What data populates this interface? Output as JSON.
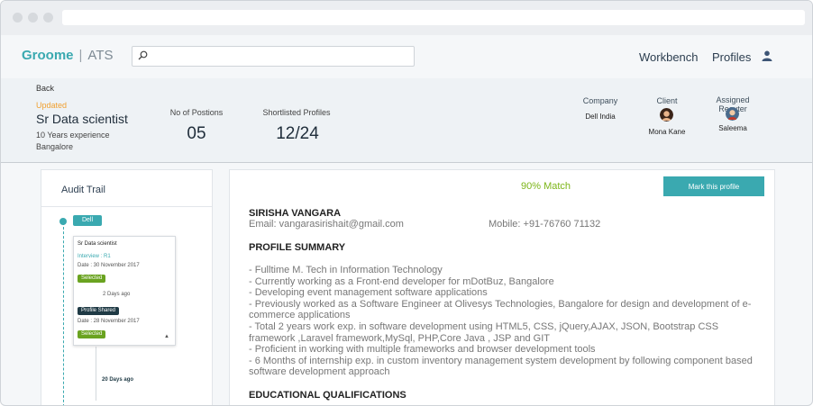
{
  "brand": {
    "name": "Groome",
    "product": "ATS"
  },
  "search": {
    "placeholder": ""
  },
  "nav": {
    "workbench": "Workbench",
    "profiles": "Profiles"
  },
  "header": {
    "back": "Back",
    "status": "Updated",
    "job_title": "Sr Data scientist",
    "experience": "10 Years experience",
    "location": "Bangalore",
    "positions_label": "No of Postions",
    "positions_value": "05",
    "shortlisted_label": "Shortlisted Profiles",
    "shortlisted_value": "12/24",
    "company_label": "Company",
    "company_value": "Dell India",
    "client_label": "Client",
    "client_value": "Mona Kane",
    "recruiter_label": "Assigned Recuter",
    "recruiter_value": "Saleema"
  },
  "audit": {
    "title": "Audit Trail",
    "company_tag": "Dell",
    "card": {
      "title": "Sr Data scientist",
      "interview": "Interview : R1",
      "date1": "Date : 30 November 2017",
      "status1": "Selected",
      "days1": "2 Days ago",
      "status2": "Profile Shared",
      "date2": "Date : 28 November 2017",
      "status3": "Selected"
    },
    "days2": "20 Days ago"
  },
  "profile": {
    "match": "90% Match",
    "mark_button": "Mark this profile",
    "name": "SIRISHA VANGARA",
    "email": "Email: vangarasirishait@gmail.com",
    "mobile": "Mobile: +91-76760 71132",
    "summary_heading": "PROFILE SUMMARY",
    "summary": [
      "- Fulltime M. Tech in Information Technology",
      "- Currently working as a Front-end developer for mDotBuz, Bangalore",
      "- Developing event management software applications",
      "- Previously worked as a Software Engineer at Olivesys Technologies, Bangalore for design and development of e-commerce applications",
      "- Total 2 years work exp. in software development using HTML5, CSS, jQuery,AJAX, JSON, Bootstrap CSS framework ,Laravel framework,MySql, PHP,Core  Java , JSP and GIT",
      "- Proficient in working with multiple frameworks and browser development tools",
      "- 6 Months of internship exp. in custom inventory management system development by following component based software development approach"
    ],
    "education_heading": "EDUCATIONAL QUALIFICATIONS"
  },
  "colors": {
    "accent": "#3aa9b0",
    "match": "#7cb518",
    "updated": "#f0a030",
    "selected": "#6aa320"
  },
  "icons": [
    "search-icon",
    "user-icon",
    "caret-up-icon"
  ]
}
